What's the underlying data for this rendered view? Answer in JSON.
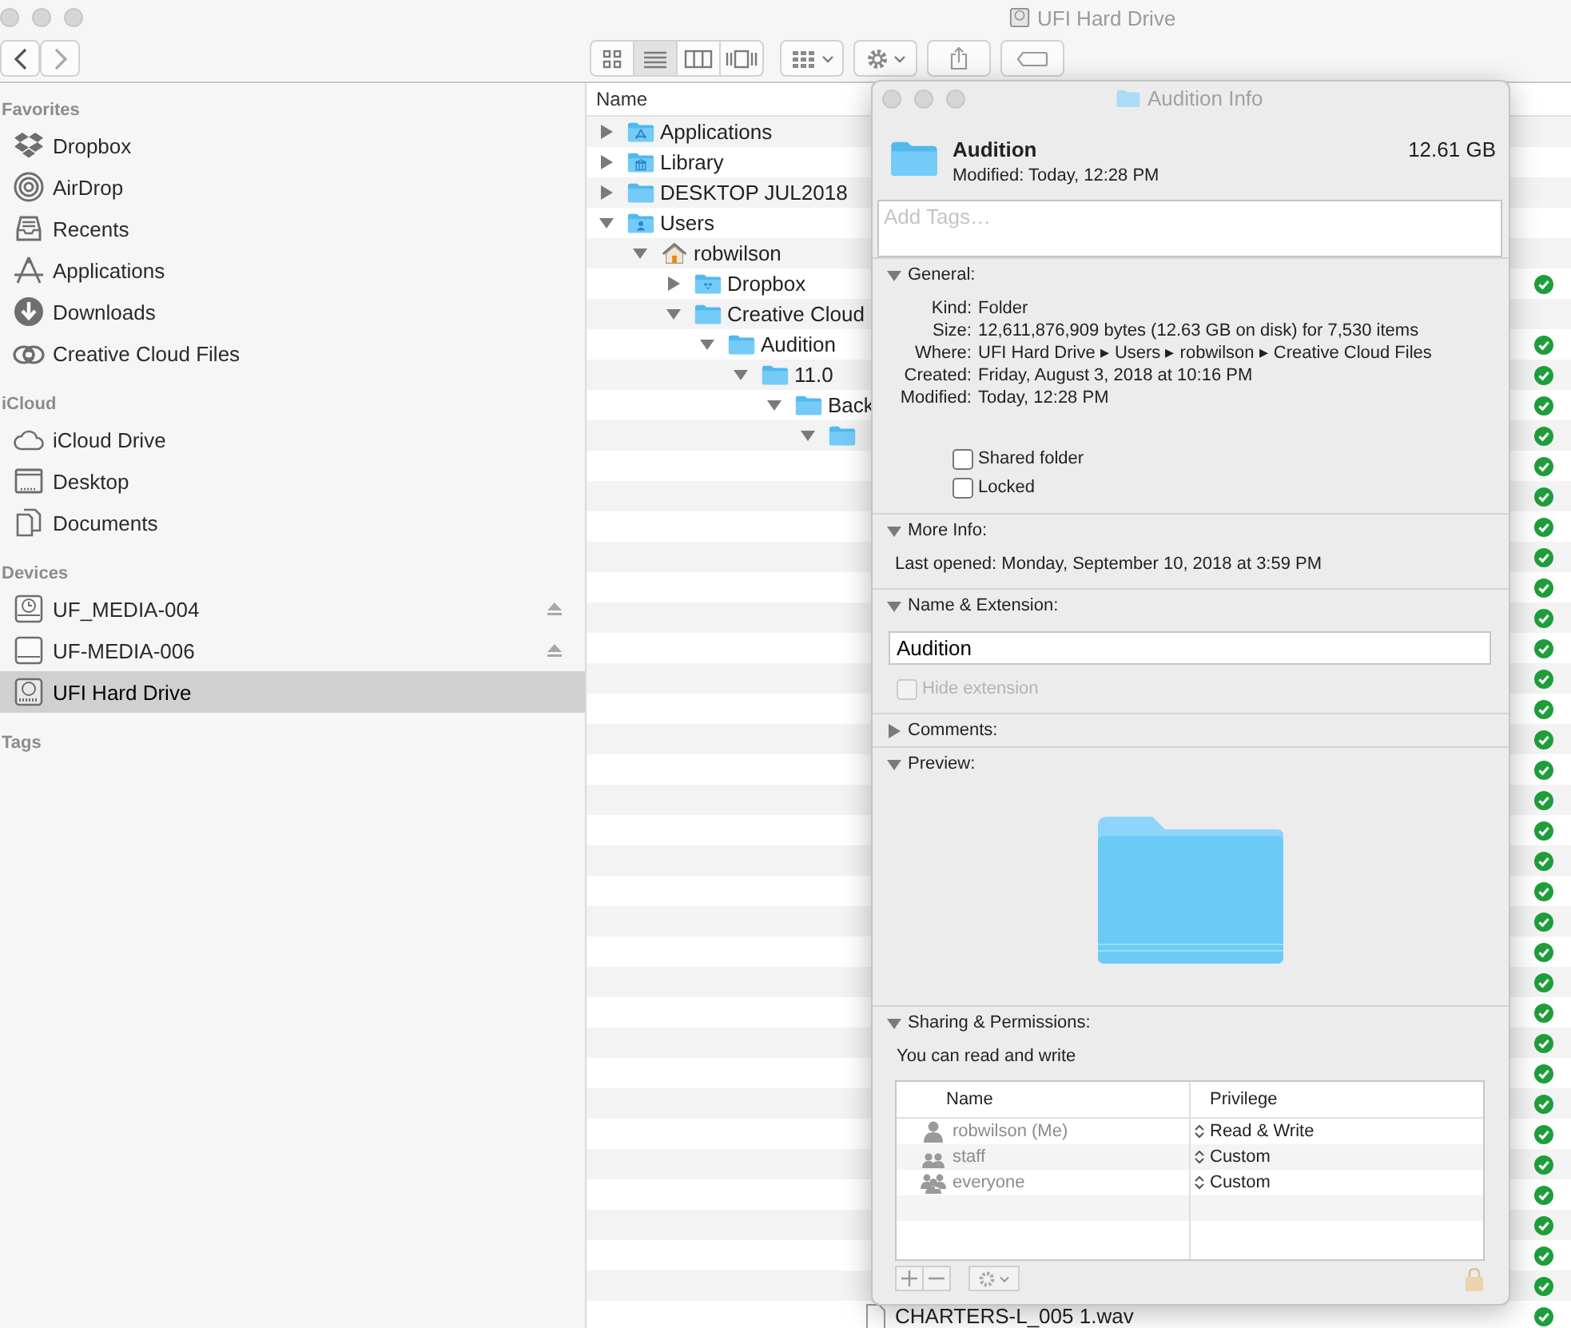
{
  "window": {
    "title": "UFI Hard Drive"
  },
  "toolbar": {
    "view_buttons": [
      {
        "selected": false
      },
      {
        "selected": true
      },
      {
        "selected": false
      },
      {
        "selected": false
      }
    ]
  },
  "sidebar": {
    "sections": [
      {
        "title": "Favorites",
        "items": [
          {
            "label": "Dropbox",
            "selected": false,
            "ejectable": false
          },
          {
            "label": "AirDrop",
            "selected": false,
            "ejectable": false
          },
          {
            "label": "Recents",
            "selected": false,
            "ejectable": false
          },
          {
            "label": "Applications",
            "selected": false,
            "ejectable": false
          },
          {
            "label": "Downloads",
            "selected": false,
            "ejectable": false
          },
          {
            "label": "Creative Cloud Files",
            "selected": false,
            "ejectable": false
          }
        ]
      },
      {
        "title": "iCloud",
        "items": [
          {
            "label": "iCloud Drive",
            "selected": false,
            "ejectable": false
          },
          {
            "label": "Desktop",
            "selected": false,
            "ejectable": false
          },
          {
            "label": "Documents",
            "selected": false,
            "ejectable": false
          }
        ]
      },
      {
        "title": "Devices",
        "items": [
          {
            "label": "UF_MEDIA-004",
            "selected": false,
            "ejectable": true
          },
          {
            "label": "UF-MEDIA-006",
            "selected": false,
            "ejectable": true
          },
          {
            "label": "UFI Hard Drive",
            "selected": true,
            "ejectable": false
          }
        ]
      },
      {
        "title": "Tags"
      }
    ]
  },
  "file_list": {
    "columns": [
      "Name"
    ],
    "rows": [
      {
        "name": "Applications",
        "kind": "applications",
        "expanded": false,
        "synced": false
      },
      {
        "name": "Library",
        "kind": "library",
        "expanded": false,
        "synced": false
      },
      {
        "name": "DESKTOP JUL2018",
        "kind": "folder",
        "expanded": false,
        "synced": false
      },
      {
        "name": "Users",
        "kind": "users",
        "expanded": true,
        "synced": false,
        "children": [
          {
            "name": "robwilson",
            "kind": "home",
            "expanded": true,
            "synced": false,
            "children": [
              {
                "name": "Dropbox",
                "kind": "dropbox",
                "expanded": false,
                "synced": true
              },
              {
                "name": "Creative Cloud",
                "kind": "folder",
                "expanded": true,
                "synced": false,
                "children": [
                  {
                    "name": "Audition",
                    "kind": "folder",
                    "expanded": true,
                    "synced": true,
                    "children": [
                      {
                        "name": "11.0",
                        "kind": "folder",
                        "expanded": true,
                        "synced": true,
                        "children": [
                          {
                            "name": "Back",
                            "kind": "folder",
                            "expanded": true,
                            "synced": true,
                            "children": [
                              {
                                "kind": "folder",
                                "expanded": true,
                                "synced": true,
                                "children": [
                                  {
                                    "synced": true
                                  },
                                  {
                                    "synced": true
                                  },
                                  {
                                    "synced": true
                                  },
                                  {
                                    "synced": true
                                  },
                                  {
                                    "synced": true
                                  },
                                  {
                                    "synced": true
                                  },
                                  {
                                    "synced": true
                                  },
                                  {
                                    "synced": true
                                  },
                                  {
                                    "synced": true
                                  },
                                  {
                                    "synced": true
                                  },
                                  {
                                    "synced": true
                                  },
                                  {
                                    "synced": true
                                  },
                                  {
                                    "synced": true
                                  },
                                  {
                                    "synced": true
                                  },
                                  {
                                    "synced": true
                                  },
                                  {
                                    "synced": true
                                  },
                                  {
                                    "synced": true
                                  },
                                  {
                                    "synced": true
                                  },
                                  {
                                    "synced": true
                                  },
                                  {
                                    "synced": true
                                  },
                                  {
                                    "synced": true
                                  },
                                  {
                                    "synced": true
                                  },
                                  {
                                    "synced": true
                                  },
                                  {
                                    "synced": true
                                  },
                                  {
                                    "synced": true
                                  },
                                  {
                                    "synced": true
                                  },
                                  {
                                    "synced": true
                                  },
                                  {
                                    "synced": true
                                  },
                                  {
                                    "name": "CHARTERS-L_005 1.wav",
                                    "kind": "file",
                                    "synced": true
                                  }
                                ]
                              }
                            ]
                          }
                        ]
                      }
                    ]
                  }
                ]
              }
            ]
          }
        ]
      }
    ]
  },
  "info": {
    "title": "Audition Info",
    "name": "Audition",
    "modified": "Modified: Today, 12:28 PM",
    "size": "12.61 GB",
    "tags": {
      "placeholder": "Add Tags…"
    },
    "sections": [
      {
        "kind": "general",
        "title": "General:",
        "expanded": true,
        "fields": [
          {
            "label": "Kind:",
            "value": "Folder"
          },
          {
            "label": "Size:",
            "value": "12,611,876,909 bytes (12.63 GB on disk) for 7,530 items"
          },
          {
            "label": "Where:",
            "value": "UFI Hard Drive ▸ Users ▸ robwilson ▸ Creative Cloud Files"
          },
          {
            "label": "Created:",
            "value": "Friday, August 3, 2018 at 10:16 PM"
          },
          {
            "label": "Modified:",
            "value": "Today, 12:28 PM"
          }
        ],
        "checkboxes": [
          {
            "label": "Shared folder",
            "checked": false
          },
          {
            "label": "Locked",
            "checked": false
          }
        ]
      },
      {
        "kind": "more_info",
        "title": "More Info:",
        "expanded": true,
        "fields": [
          {
            "label": "Last opened:",
            "value": "Monday, September 10, 2018 at 3:59 PM"
          }
        ]
      },
      {
        "kind": "name_extension",
        "title": "Name & Extension:",
        "expanded": true,
        "value": "Audition",
        "checkbox": {
          "label": "Hide extension",
          "checked": false,
          "disabled": true
        }
      },
      {
        "kind": "comments",
        "title": "Comments:",
        "expanded": false
      },
      {
        "kind": "preview",
        "title": "Preview:",
        "expanded": true
      },
      {
        "kind": "sharing",
        "title": "Sharing & Permissions:",
        "expanded": true,
        "note": "You can read and write",
        "columns": [
          "Name",
          "Privilege"
        ],
        "rows": [
          {
            "name": "robwilson (Me)",
            "privilege": "Read & Write"
          },
          {
            "name": "staff",
            "privilege": "Custom"
          },
          {
            "name": "everyone",
            "privilege": "Custom"
          }
        ]
      }
    ]
  }
}
